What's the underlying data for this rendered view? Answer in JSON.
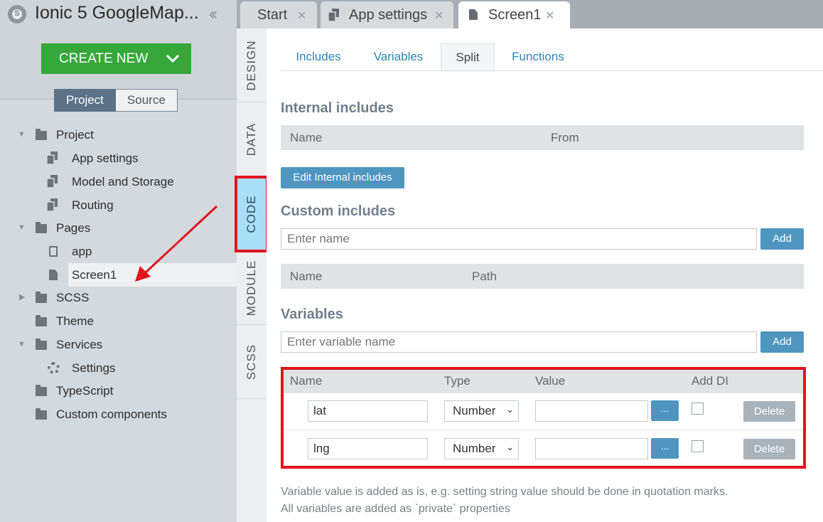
{
  "app": {
    "title": "Ionic 5 GoogleMap...",
    "logo_letter": "S"
  },
  "sidebar": {
    "create_label": "CREATE NEW",
    "toggle": {
      "project": "Project",
      "source": "Source"
    },
    "tree": [
      {
        "label": "Project"
      },
      {
        "label": "App settings"
      },
      {
        "label": "Model and Storage"
      },
      {
        "label": "Routing"
      },
      {
        "label": "Pages"
      },
      {
        "label": "app"
      },
      {
        "label": "Screen1"
      },
      {
        "label": "SCSS"
      },
      {
        "label": "Theme"
      },
      {
        "label": "Services"
      },
      {
        "label": "Settings"
      },
      {
        "label": "TypeScript"
      },
      {
        "label": "Custom components"
      }
    ]
  },
  "vtabs": {
    "design": "DESIGN",
    "data": "DATA",
    "code": "CODE",
    "module": "MODULE",
    "scss": "SCSS"
  },
  "tabs": {
    "start": "Start",
    "app_settings": "App settings",
    "screen1": "Screen1"
  },
  "subtabs": {
    "includes": "Includes",
    "variables": "Variables",
    "split": "Split",
    "functions": "Functions"
  },
  "internal": {
    "title": "Internal includes",
    "col_name": "Name",
    "col_from": "From",
    "edit_btn": "Edit Internal includes"
  },
  "custom": {
    "title": "Custom includes",
    "placeholder": "Enter name",
    "add": "Add",
    "col_name": "Name",
    "col_path": "Path"
  },
  "variables": {
    "title": "Variables",
    "placeholder": "Enter variable name",
    "add": "Add",
    "cols": {
      "name": "Name",
      "type": "Type",
      "value": "Value",
      "add_di": "Add DI"
    },
    "rows": [
      {
        "name": "lat",
        "type": "Number",
        "dots": "...",
        "delete": "Delete"
      },
      {
        "name": "lng",
        "type": "Number",
        "dots": "...",
        "delete": "Delete"
      }
    ],
    "note1": "Variable value is added as is, e.g. setting string value should be done in quotation marks.",
    "note2": "All variables are added as `private` properties"
  }
}
